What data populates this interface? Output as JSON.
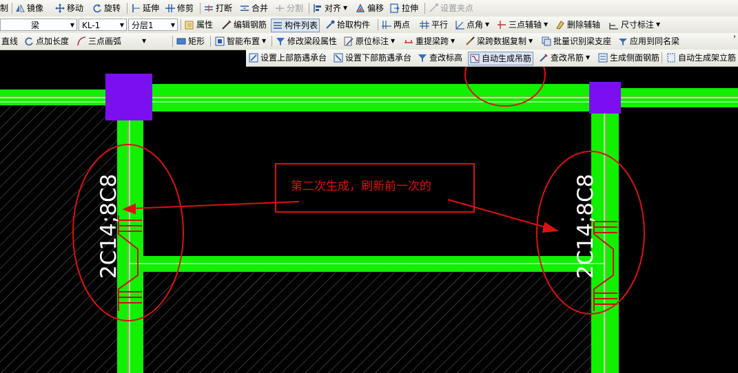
{
  "toolbar1": {
    "copy": "制",
    "mirror": "镜像",
    "move": "移动",
    "rotate": "旋转",
    "extend": "延伸",
    "trim": "修剪",
    "break": "打断",
    "merge": "合并",
    "split": "分割",
    "align": "对齐",
    "offset": "偏移",
    "stretch": "拉伸",
    "set_pinch_point": "设置夹点"
  },
  "toolbar2": {
    "category_value": "梁",
    "component_value": "KL-1",
    "layer_value": "分层1",
    "properties": "属性",
    "edit_rebar": "编辑钢筋",
    "component_list": "构件列表",
    "pick_component": "拾取构件",
    "two_points": "两点",
    "parallel": "平行",
    "point_angle": "点角",
    "three_point_axis": "三点辅轴",
    "delete_axis": "删除辅轴",
    "dimension": "尺寸标注"
  },
  "toolbar3": {
    "line": "直线",
    "point_length": "点加长度",
    "three_point_arc": "三点画弧",
    "rectangle": "矩形",
    "smart_layout": "智能布置",
    "modify_segment_props": "修改梁段属性",
    "inplace_label": "原位标注",
    "re_extract_span": "重提梁跨",
    "span_data_copy": "梁跨数据复制",
    "batch_identify_support": "批量识别梁支座",
    "apply_same_name": "应用到同名梁"
  },
  "toolbar4": {
    "set_top_rebar_cap": "设置上部筋遇承台",
    "set_bottom_rebar_cap": "设置下部筋遇承台",
    "check_elevation": "查改标高",
    "auto_hanger": "自动生成吊筋",
    "check_hanger": "查改吊筋",
    "side_rebar": "生成侧面钢筋",
    "auto_stirrup": "自动生成架立筋"
  },
  "canvas": {
    "annotation_text": "第二次生成，刷新前一次的",
    "rebar_label_left": "2C14;8C8",
    "rebar_label_right": "2C14;8C8"
  },
  "colors": {
    "beam_green": "#11f000",
    "column_purple": "#7b0ff0",
    "annotation_red": "#dd1111",
    "hanger_red": "#cc1010",
    "outline_pink": "#ff6fa0"
  }
}
